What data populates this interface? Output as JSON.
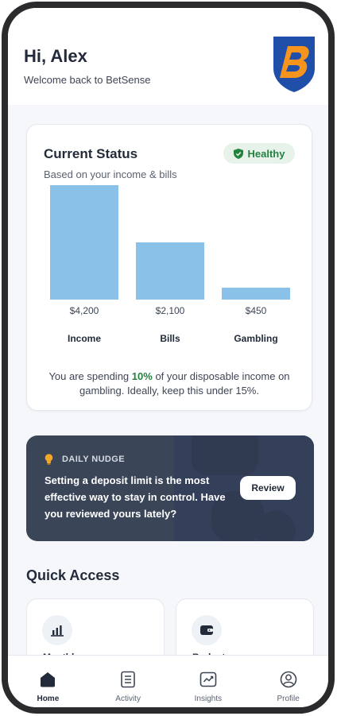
{
  "header": {
    "greeting": "Hi, Alex",
    "subtitle": "Welcome back to BetSense",
    "logo_letter": "B"
  },
  "status_card": {
    "title": "Current Status",
    "subtitle": "Based on your income & bills",
    "badge": "Healthy",
    "note_pre": "You are spending",
    "note_pct": "10%",
    "note_post": "of your disposable income on gambling. Ideally, keep this under 15%."
  },
  "chart_data": {
    "type": "bar",
    "categories": [
      "Income",
      "Bills",
      "Gambling"
    ],
    "values": [
      4200,
      2100,
      450
    ],
    "value_labels": [
      "$4,200",
      "$2,100",
      "$450"
    ],
    "ylim": [
      0,
      4200
    ],
    "grid": false,
    "colors": [
      "#89c1e9"
    ]
  },
  "nudge": {
    "tag": "DAILY NUDGE",
    "text": "Setting a deposit limit is the most effective way to stay in control. Have you reviewed yours lately?",
    "button": "Review"
  },
  "quick_access": {
    "title": "Quick Access",
    "items": [
      {
        "label": "Monthly",
        "icon": "bar-chart-icon"
      },
      {
        "label": "Budget",
        "icon": "wallet-icon"
      }
    ]
  },
  "nav": {
    "items": [
      {
        "label": "Home",
        "icon": "home-icon",
        "active": true
      },
      {
        "label": "Activity",
        "icon": "list-icon",
        "active": false
      },
      {
        "label": "Insights",
        "icon": "trend-icon",
        "active": false
      },
      {
        "label": "Profile",
        "icon": "profile-icon",
        "active": false
      }
    ]
  },
  "colors": {
    "bar": "#89c1e9",
    "healthy": "#24823f",
    "nudge_bg": "#3b4558",
    "logo_blue": "#1f4fa8",
    "logo_orange": "#f7941d"
  }
}
